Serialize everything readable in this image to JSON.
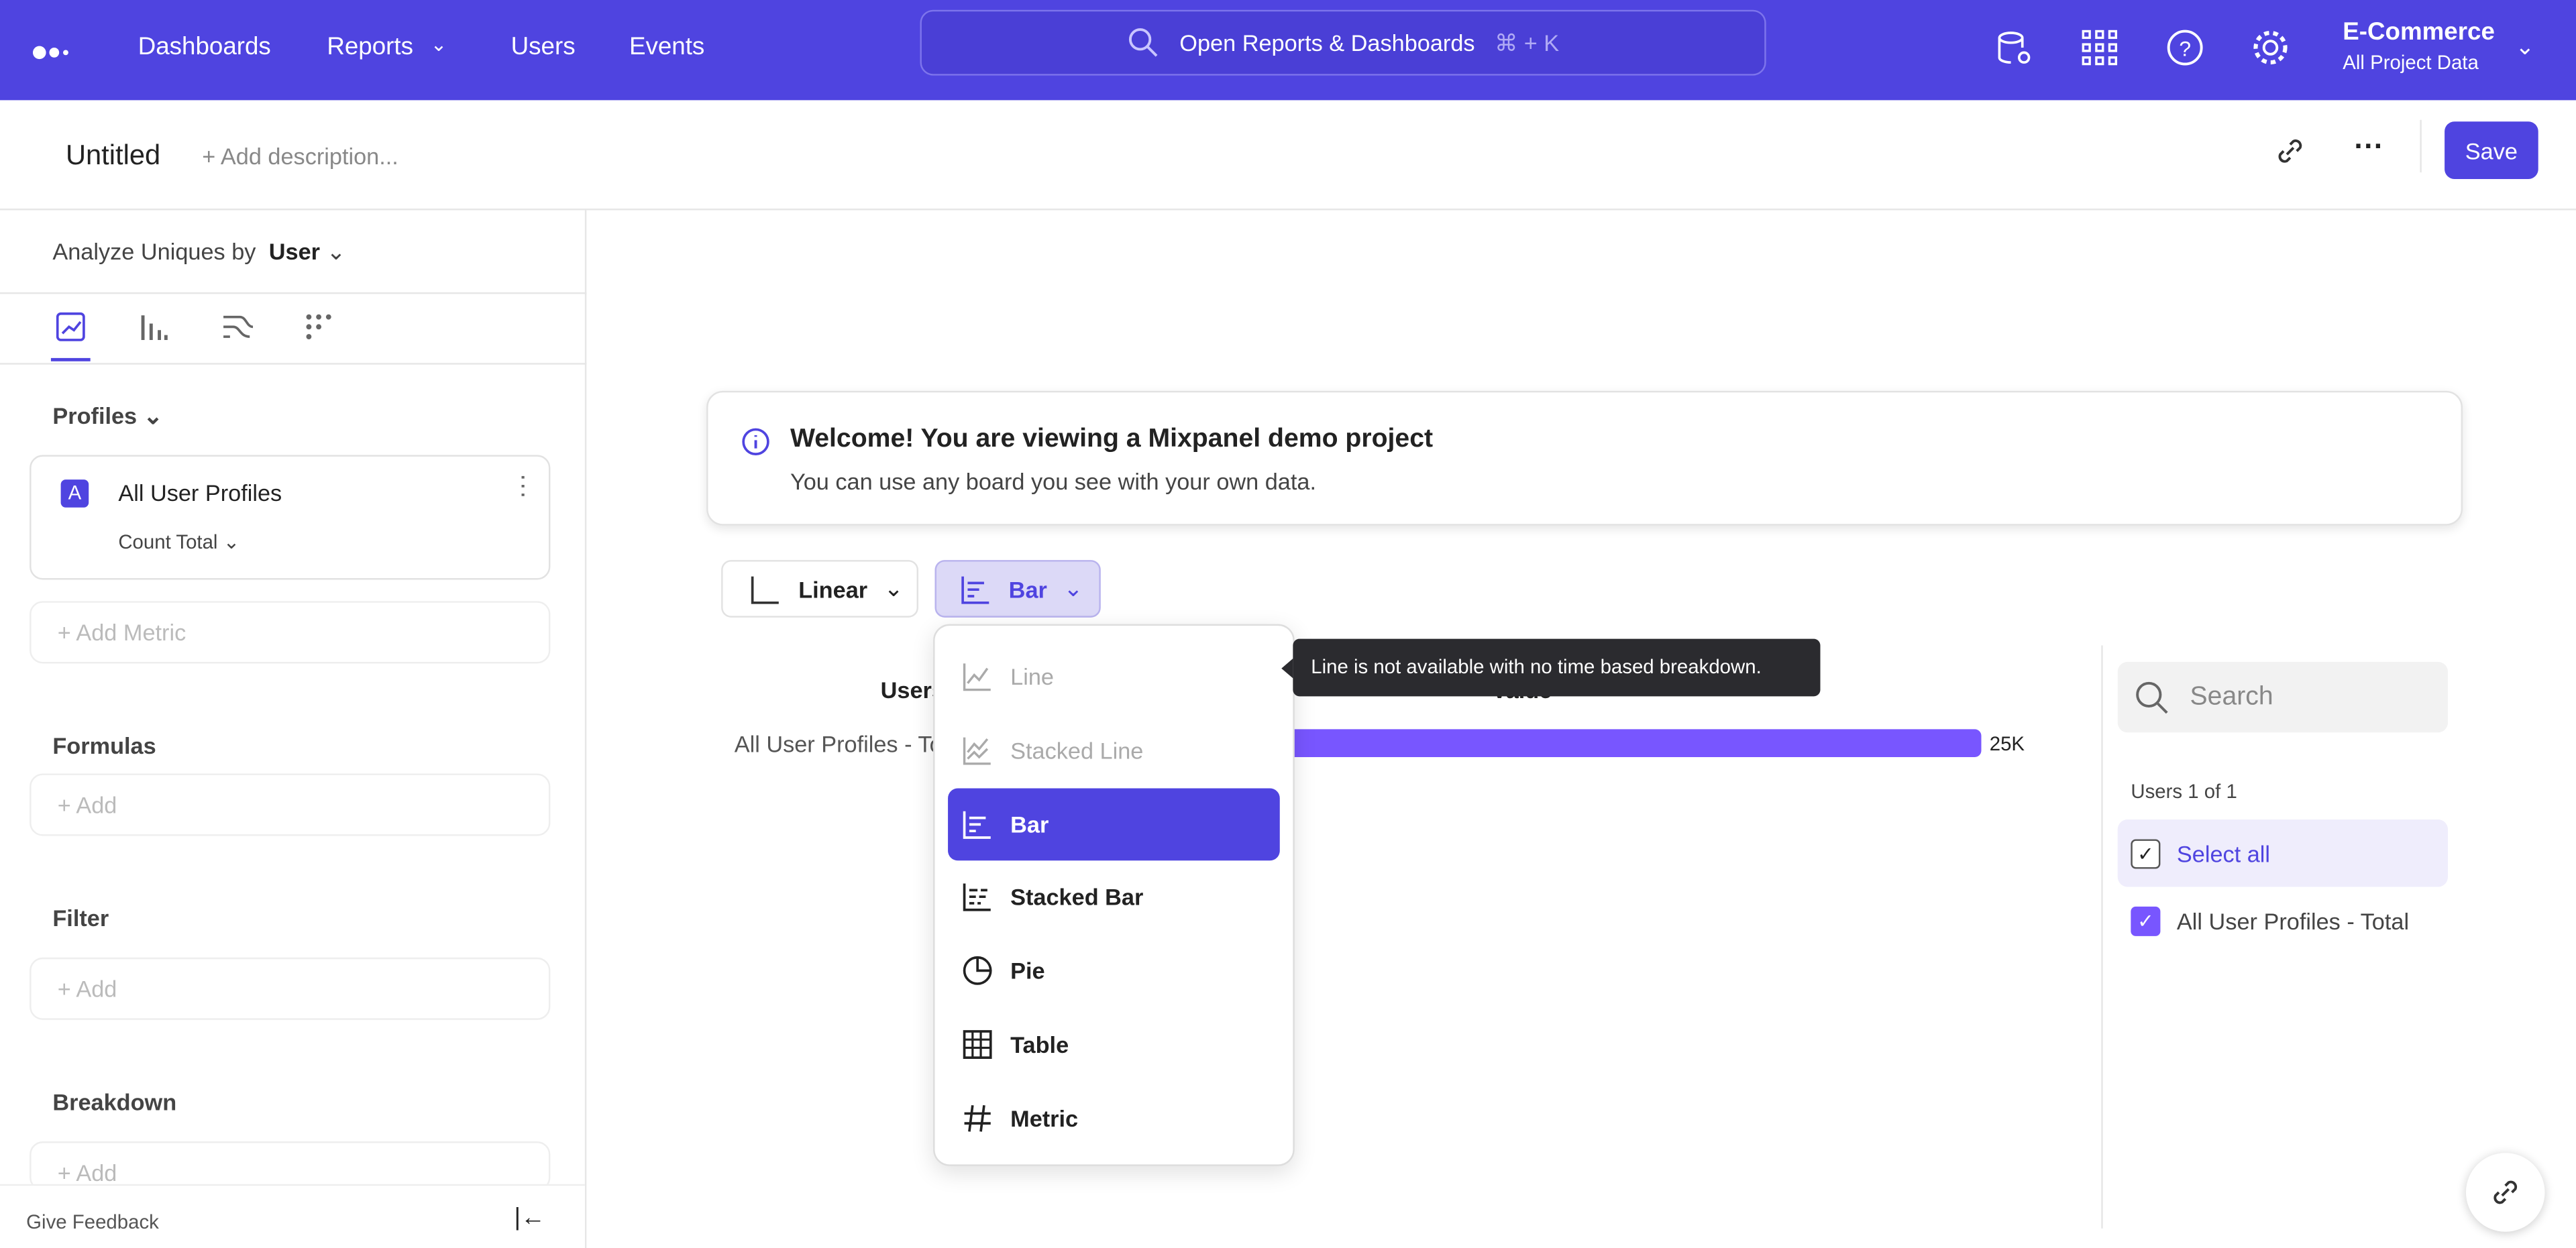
{
  "topbar": {
    "nav": [
      "Dashboards",
      "Reports",
      "Users",
      "Events"
    ],
    "search_placeholder": "Open Reports & Dashboards",
    "shortcut": "⌘ + K",
    "project_name": "E-Commerce",
    "project_sub": "All Project Data"
  },
  "header": {
    "title": "Untitled",
    "description_placeholder": "+ Add description...",
    "save": "Save"
  },
  "sidebar": {
    "analyze_label": "Analyze Uniques by",
    "analyze_value": "User",
    "profiles": "Profiles",
    "metric_letter": "A",
    "metric_name": "All User Profiles",
    "metric_agg": "Count Total",
    "add_metric": "+ Add Metric",
    "formulas": "Formulas",
    "filter": "Filter",
    "breakdown": "Breakdown",
    "add": "+ Add",
    "feedback": "Give Feedback"
  },
  "banner": {
    "title": "Welcome! You are viewing a Mixpanel demo project",
    "text": "You can use any board you see with your own data."
  },
  "controls": {
    "scale": "Linear",
    "chart_type": "Bar"
  },
  "menu": {
    "items": [
      {
        "label": "Line",
        "disabled": true
      },
      {
        "label": "Stacked Line",
        "disabled": true
      },
      {
        "label": "Bar",
        "selected": true
      },
      {
        "label": "Stacked Bar"
      },
      {
        "label": "Pie"
      },
      {
        "label": "Table"
      },
      {
        "label": "Metric"
      }
    ]
  },
  "tooltip": "Line is not available with no time based breakdown.",
  "chart_data": {
    "type": "bar",
    "column_headers": [
      "Users",
      "Value"
    ],
    "categories": [
      "All User Profiles - Total"
    ],
    "values": [
      25000
    ],
    "value_labels": [
      "25K"
    ],
    "bar_color": "#7856ff"
  },
  "legend": {
    "search_placeholder": "Search",
    "count": "Users 1 of 1",
    "select_all": "Select all",
    "items": [
      "All User Profiles - Total"
    ]
  },
  "colors": {
    "brand": "#4f44e0",
    "bar": "#7856ff"
  }
}
